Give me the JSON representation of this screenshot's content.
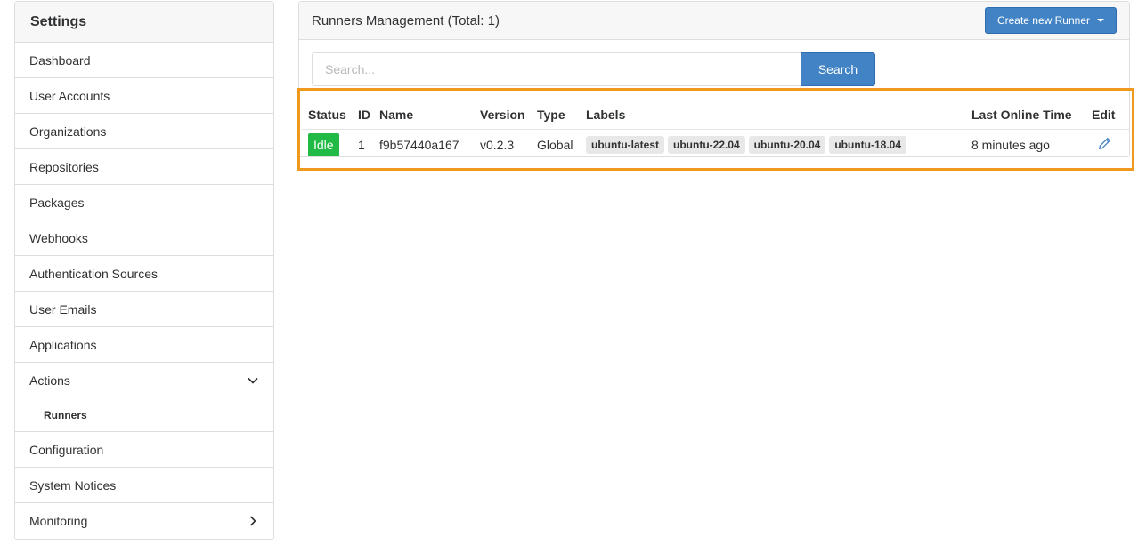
{
  "sidebar": {
    "title": "Settings",
    "items": [
      {
        "label": "Dashboard"
      },
      {
        "label": "User Accounts"
      },
      {
        "label": "Organizations"
      },
      {
        "label": "Repositories"
      },
      {
        "label": "Packages"
      },
      {
        "label": "Webhooks"
      },
      {
        "label": "Authentication Sources"
      },
      {
        "label": "User Emails"
      },
      {
        "label": "Applications"
      },
      {
        "label": "Actions",
        "icon": "chevron-down-icon"
      },
      {
        "label": "Runners"
      },
      {
        "label": "Configuration"
      },
      {
        "label": "System Notices"
      },
      {
        "label": "Monitoring",
        "icon": "chevron-right-icon"
      }
    ]
  },
  "panel": {
    "title": "Runners Management (Total: 1)",
    "create_button": "Create new Runner"
  },
  "search": {
    "placeholder": "Search...",
    "button": "Search"
  },
  "table": {
    "headers": [
      "Status",
      "ID",
      "Name",
      "Version",
      "Type",
      "Labels",
      "Last Online Time",
      "Edit"
    ],
    "rows": [
      {
        "status": "Idle",
        "id": "1",
        "name": "f9b57440a167",
        "version": "v0.2.3",
        "type": "Global",
        "labels": [
          "ubuntu-latest",
          "ubuntu-22.04",
          "ubuntu-20.04",
          "ubuntu-18.04"
        ],
        "last_online": "8 minutes ago",
        "edit_icon": "pencil-icon"
      }
    ]
  },
  "colors": {
    "accent": "#4183c4",
    "status_idle": "#21ba45",
    "highlight": "#f0991f"
  }
}
